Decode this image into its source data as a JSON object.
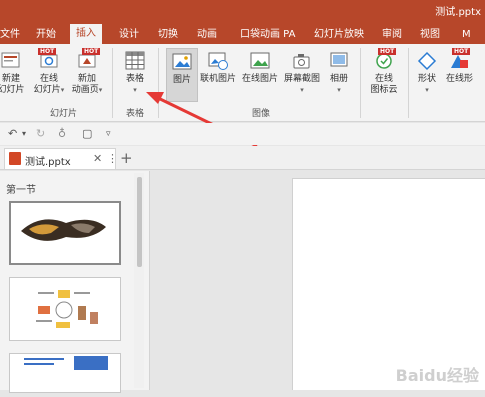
{
  "window": {
    "doc_title": "测试.pptx"
  },
  "ribbon_tabs": [
    {
      "label": "文件"
    },
    {
      "label": "开始"
    },
    {
      "label": "插入"
    },
    {
      "label": "设计"
    },
    {
      "label": "切换"
    },
    {
      "label": "动画"
    },
    {
      "label": "口袋动画 PA"
    },
    {
      "label": "幻灯片放映"
    },
    {
      "label": "审阅"
    },
    {
      "label": "视图"
    },
    {
      "label": "M"
    }
  ],
  "ribbon": {
    "new_slide_label_1": "新建",
    "new_slide_label_2": "幻灯片",
    "online_slide_label_1": "在线",
    "online_slide_label_2": "幻灯片",
    "add_anim_label_1": "新加",
    "add_anim_label_2": "动画页",
    "table_label": "表格",
    "picture_label": "图片",
    "online_picture_label": "联机图片",
    "web_picture_label": "在线图片",
    "screenshot_label": "屏幕截图",
    "album_label": "相册",
    "online_icon_label_1": "在线",
    "online_icon_label_2": "图标云",
    "shape_label": "形状",
    "online_shape_label": "在线形",
    "hot_badge": "HOT",
    "group_slides": "幻灯片",
    "group_table": "表格",
    "group_images": "图像"
  },
  "doc_tab": {
    "label": "测试.pptx"
  },
  "thumb_panel": {
    "section_label": "第一节"
  },
  "watermark": "Baidu经验",
  "colors": {
    "brand": "#b7472a",
    "arrow": "#e53935"
  }
}
